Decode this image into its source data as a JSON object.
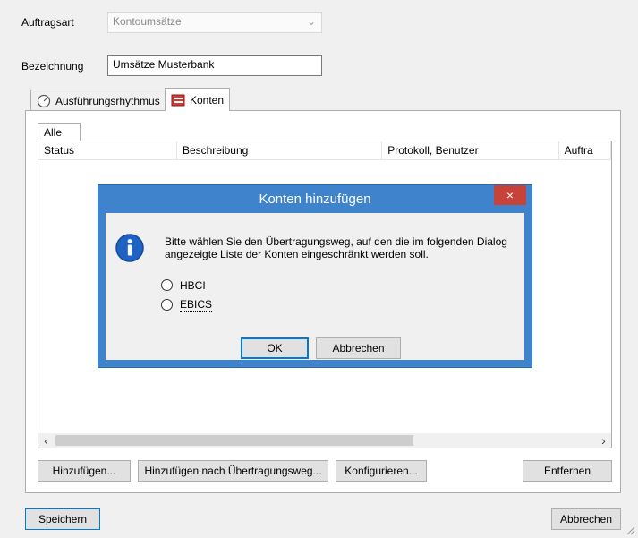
{
  "form": {
    "auftragsart_label": "Auftragsart",
    "auftragsart_value": "Kontoumsätze",
    "bezeichnung_label": "Bezeichnung",
    "bezeichnung_value": "Umsätze Musterbank"
  },
  "tabs": [
    {
      "label": "Ausführungsrhythmus",
      "icon": "clock-icon"
    },
    {
      "label": "Konten",
      "icon": "accounts-book-icon"
    }
  ],
  "filter_tab": "Alle",
  "table": {
    "columns": [
      "Status",
      "Beschreibung",
      "Protokoll, Benutzer",
      "Auftra"
    ]
  },
  "panel_buttons": {
    "add": "Hinzufügen...",
    "add_by_channel": "Hinzufügen nach Übertragungsweg...",
    "configure": "Konfigurieren...",
    "remove": "Entfernen"
  },
  "footer": {
    "save": "Speichern",
    "cancel": "Abbrechen"
  },
  "dialog": {
    "title": "Konten hinzufügen",
    "close": "×",
    "message_line1": "Bitte wählen Sie den Übertragungsweg, auf den die im folgenden Dialog",
    "message_line2": "angezeigte Liste der Konten eingeschränkt werden soll.",
    "options": [
      "HBCI",
      "EBICS"
    ],
    "ok": "OK",
    "cancel": "Abbrechen"
  },
  "scroll": {
    "left_arrow": "‹",
    "right_arrow": "›"
  },
  "colors": {
    "dialog_frame": "#3f83cc",
    "close_button": "#c7433a",
    "accent": "#0078d7"
  }
}
